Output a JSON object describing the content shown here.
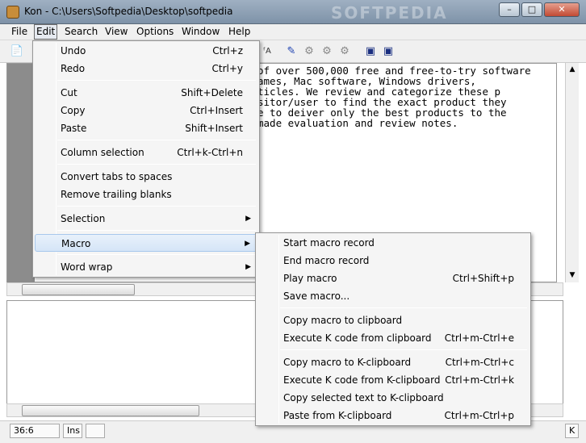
{
  "window": {
    "title": "Kon - C:\\Users\\Softpedia\\Desktop\\softpedia",
    "watermark": "SOFTPEDIA"
  },
  "menubar": [
    "File",
    "Edit",
    "Search",
    "View",
    "Options",
    "Window",
    "Help"
  ],
  "editor": {
    "lines": [
      "of over 500,000 free and free-to-try software",
      "ames, Mac software, Windows drivers,",
      "ticles. We review and categorize these p",
      "sitor/user to find the exact product they",
      "e to deiver only the best products to the",
      "made evaluation and review notes."
    ]
  },
  "status": {
    "position": "36:6",
    "mode": "Ins",
    "right": "K"
  },
  "edit_menu": {
    "groups": [
      [
        {
          "label": "Undo",
          "key": "Ctrl+z"
        },
        {
          "label": "Redo",
          "key": "Ctrl+y"
        }
      ],
      [
        {
          "label": "Cut",
          "key": "Shift+Delete"
        },
        {
          "label": "Copy",
          "key": "Ctrl+Insert"
        },
        {
          "label": "Paste",
          "key": "Shift+Insert"
        }
      ],
      [
        {
          "label": "Column selection",
          "key": "Ctrl+k-Ctrl+n"
        }
      ],
      [
        {
          "label": "Convert tabs to spaces",
          "key": ""
        },
        {
          "label": "Remove trailing blanks",
          "key": ""
        }
      ],
      [
        {
          "label": "Selection",
          "key": ""
        }
      ],
      [
        {
          "label": "Macro",
          "key": ""
        }
      ],
      [
        {
          "label": "Word wrap",
          "key": ""
        }
      ]
    ]
  },
  "macro_menu": {
    "groups": [
      [
        {
          "label": "Start macro record",
          "key": ""
        },
        {
          "label": "End macro record",
          "key": ""
        },
        {
          "label": "Play macro",
          "key": "Ctrl+Shift+p"
        },
        {
          "label": "Save macro...",
          "key": ""
        }
      ],
      [
        {
          "label": "Copy macro to clipboard",
          "key": ""
        },
        {
          "label": "Execute K code from clipboard",
          "key": "Ctrl+m-Ctrl+e"
        }
      ],
      [
        {
          "label": "Copy macro to K-clipboard",
          "key": "Ctrl+m-Ctrl+c"
        },
        {
          "label": "Execute K code from K-clipboard",
          "key": "Ctrl+m-Ctrl+k"
        },
        {
          "label": "Copy selected text to K-clipboard",
          "key": ""
        },
        {
          "label": "Paste from K-clipboard",
          "key": "Ctrl+m-Ctrl+p"
        }
      ]
    ]
  }
}
